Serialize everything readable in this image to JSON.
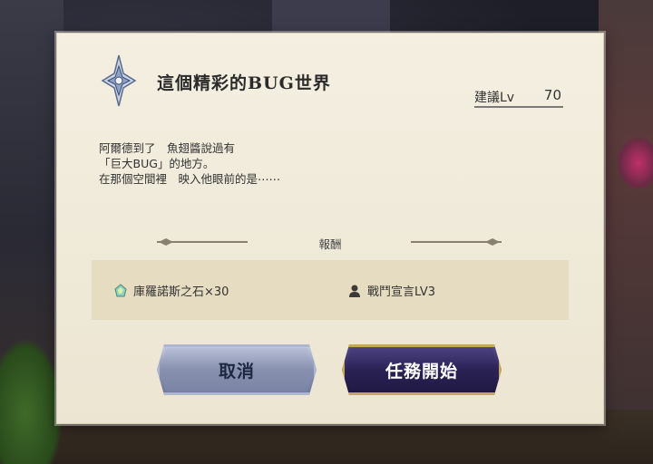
{
  "dialog": {
    "title": "這個精彩的BUG世界",
    "level_label": "建議Lv",
    "level_value": "70",
    "description": "阿爾德到了　魚翅醬說過有\n「巨大BUG」的地方。\n在那個空間裡　映入他眼前的是⋯⋯",
    "reward_title": "報酬",
    "rewards": [
      {
        "icon": "gem-stone-icon",
        "label": "庫羅諾斯之石×30"
      },
      {
        "icon": "person-icon",
        "label": "戰鬥宣言LV3"
      }
    ],
    "cancel_label": "取消",
    "start_label": "任務開始"
  },
  "colors": {
    "dialog_bg": "#f0eadb",
    "reward_panel": "#e6dcc1",
    "start_button": "#2c2456",
    "start_border": "#c6a85a",
    "cancel_button": "#8e97b6"
  }
}
